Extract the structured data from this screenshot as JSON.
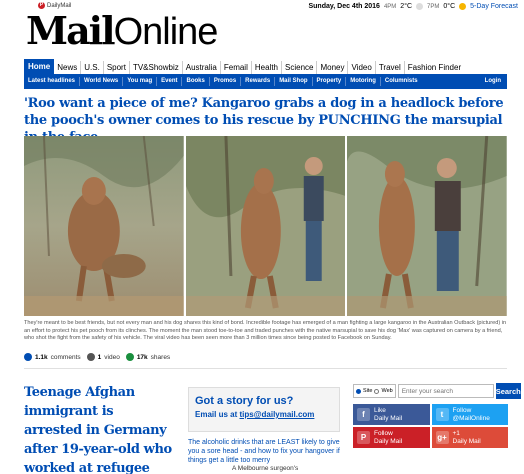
{
  "topbar": {
    "pinterest_label": "DailyMail",
    "date": "Sunday, Dec 4th 2016",
    "time1": "4PM",
    "temp1": "2°C",
    "time2": "7PM",
    "temp2": "0°C",
    "forecast_label": "5-Day Forecast"
  },
  "logo": {
    "part1": "Mail",
    "part2": "Online"
  },
  "nav": {
    "items": [
      "Home",
      "News",
      "U.S.",
      "Sport",
      "TV&Showbiz",
      "Australia",
      "Femail",
      "Health",
      "Science",
      "Money",
      "Video",
      "Travel",
      "Fashion Finder"
    ]
  },
  "subnav": {
    "items": [
      "Latest headlines",
      "World News",
      "You mag",
      "Event",
      "Books",
      "Promos",
      "Rewards",
      "Mail Shop",
      "Property",
      "Motoring",
      "Columnists"
    ],
    "login": "Login"
  },
  "article": {
    "headline": "'Roo want a piece of me? Kangaroo grabs a dog in a headlock before the pooch's owner comes to his rescue by PUNCHING the marsupial in the face",
    "caption": "They're meant to be best friends, but not every man and his dog shares this kind of bond. Incredible footage has emerged of a man fighting a large kangaroo in the Australian Outback (pictured) in an effort to protect his pet pooch from its clinches. The moment the man stood toe-to-toe and traded punches with the native marsupial to save his dog 'Max' was captured on camera by a friend, who shot the fight from the safety of his vehicle. The viral video has been seen more than 3 million times since being posted to Facebook on Sunday.",
    "comments": "1.1k",
    "comments_label": "comments",
    "videos": "1",
    "videos_label": "video",
    "shares": "17k",
    "shares_label": "shares"
  },
  "story2": {
    "headline": "Teenage Afghan immigrant is arrested in Germany after 19-year-old who worked at refugee centre and was the"
  },
  "tipbox": {
    "title": "Got a story for us?",
    "email_prefix": "Email us at",
    "email": "tips@dailymail.com"
  },
  "links": {
    "link1": "The alcoholic drinks that are LEAST likely to give you a sore head - and how to fix your hangover if things get a little too merry",
    "link2": "A Melbourne surgeon's"
  },
  "search": {
    "opt_site": "Site",
    "opt_web": "Web",
    "placeholder": "Enter your search",
    "button": "Search"
  },
  "social": [
    {
      "line1": "Like",
      "line2": "Daily Mail",
      "icon": "facebook-icon",
      "glyph": "f"
    },
    {
      "line1": "Follow",
      "line2": "@MailOnline",
      "icon": "twitter-icon",
      "glyph": "t"
    },
    {
      "line1": "Follow",
      "line2": "Daily Mail",
      "icon": "pinterest-icon",
      "glyph": "P"
    },
    {
      "line1": "+1",
      "line2": "Daily Mail",
      "icon": "google-plus-icon",
      "glyph": "g+"
    }
  ],
  "colors": {
    "accent": "#004db3",
    "headline": "#004db3"
  }
}
